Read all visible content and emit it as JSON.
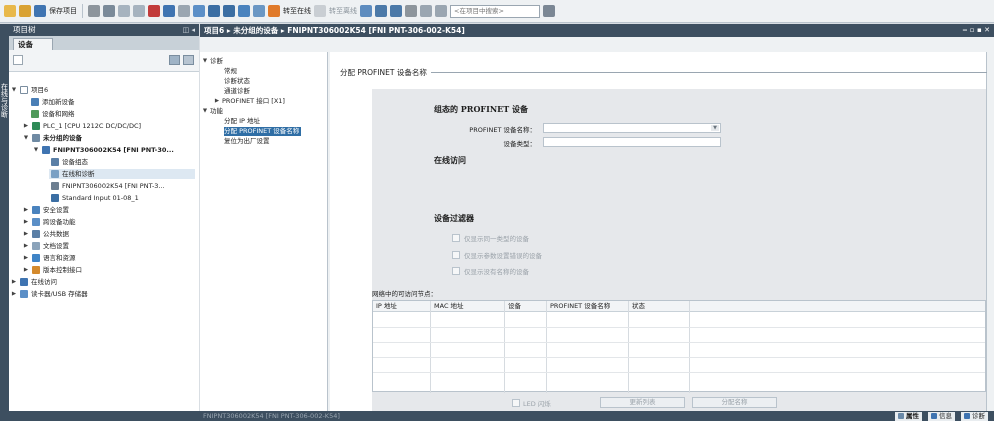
{
  "toolbar": {
    "save_project": "保存项目",
    "go_online": "转至在线",
    "go_offline": "转至离线",
    "search_placeholder": "<在项目中搜索>"
  },
  "left_strip": {
    "label": "在线与诊断"
  },
  "project_tree": {
    "title": "项目树",
    "tab": "设备",
    "items": [
      {
        "label": "项目6",
        "level": 0,
        "expanded": true
      },
      {
        "label": "添加新设备",
        "level": 1
      },
      {
        "label": "设备和网络",
        "level": 1
      },
      {
        "label": "PLC_1 [CPU 1212C DC/DC/DC]",
        "level": 1,
        "collapsed": true
      },
      {
        "label": "未分组的设备",
        "level": 1,
        "expanded": true,
        "bold": true
      },
      {
        "label": "FNIPNT306002K54 [FNI PNT-30...",
        "level": 2,
        "expanded": true,
        "bold": true
      },
      {
        "label": "设备组态",
        "level": 3
      },
      {
        "label": "在线和诊断",
        "level": 3,
        "selected": true
      },
      {
        "label": "FNIPNT306002K54 [FNI PNT-3...",
        "level": 3
      },
      {
        "label": "Standard Input 01-08_1",
        "level": 3
      },
      {
        "label": "安全设置",
        "level": 1,
        "collapsed": true
      },
      {
        "label": "跨设备功能",
        "level": 1,
        "collapsed": true
      },
      {
        "label": "公共数据",
        "level": 1,
        "collapsed": true
      },
      {
        "label": "文档设置",
        "level": 1,
        "collapsed": true
      },
      {
        "label": "语言和资源",
        "level": 1,
        "collapsed": true
      },
      {
        "label": "版本控制接口",
        "level": 1,
        "collapsed": true
      },
      {
        "label": "在线访问",
        "level": 0,
        "collapsed": true
      },
      {
        "label": "读卡器/USB 存储器",
        "level": 0,
        "collapsed": true
      }
    ]
  },
  "main": {
    "breadcrumb": "项目6 ▸ 未分组的设备 ▸ FNIPNT306002K54 [FNI PNT-306-002-K54]",
    "nav": [
      {
        "label": "诊断",
        "level": 0,
        "expanded": true
      },
      {
        "label": "常规",
        "level": 1
      },
      {
        "label": "诊断状态",
        "level": 1
      },
      {
        "label": "通道诊断",
        "level": 1
      },
      {
        "label": "PROFINET 接口 [X1]",
        "level": 1,
        "collapsed": true
      },
      {
        "label": "功能",
        "level": 0,
        "expanded": true
      },
      {
        "label": "分配 IP 地址",
        "level": 1
      },
      {
        "label": "分配 PROFINET 设备名称",
        "level": 1,
        "selected": true
      },
      {
        "label": "复位为出厂设置",
        "level": 1
      }
    ],
    "section_title": "分配 PROFINET 设备名称",
    "configured_heading": "组态的 PROFINET 设备",
    "device_name_label": "PROFINET 设备名称：",
    "device_type_label": "设备类型：",
    "online_access_heading": "在线访问",
    "filter_heading": "设备过滤器",
    "filters": [
      "仅显示同一类型的设备",
      "仅显示参数设置错误的设备",
      "仅显示没有名称的设备"
    ],
    "table_caption": "网络中的可访问节点：",
    "table_columns": [
      "IP 地址",
      "MAC 地址",
      "设备",
      "PROFINET 设备名称",
      "状态"
    ],
    "led_flash": "LED 闪烁",
    "update_list": "更新列表",
    "assign_name": "分配名称"
  },
  "statusbar": {
    "left": "FNIPNT306002K54 [FNI PNT-306-002-K54]",
    "tabs": [
      "属性",
      "信息",
      "诊断"
    ]
  }
}
